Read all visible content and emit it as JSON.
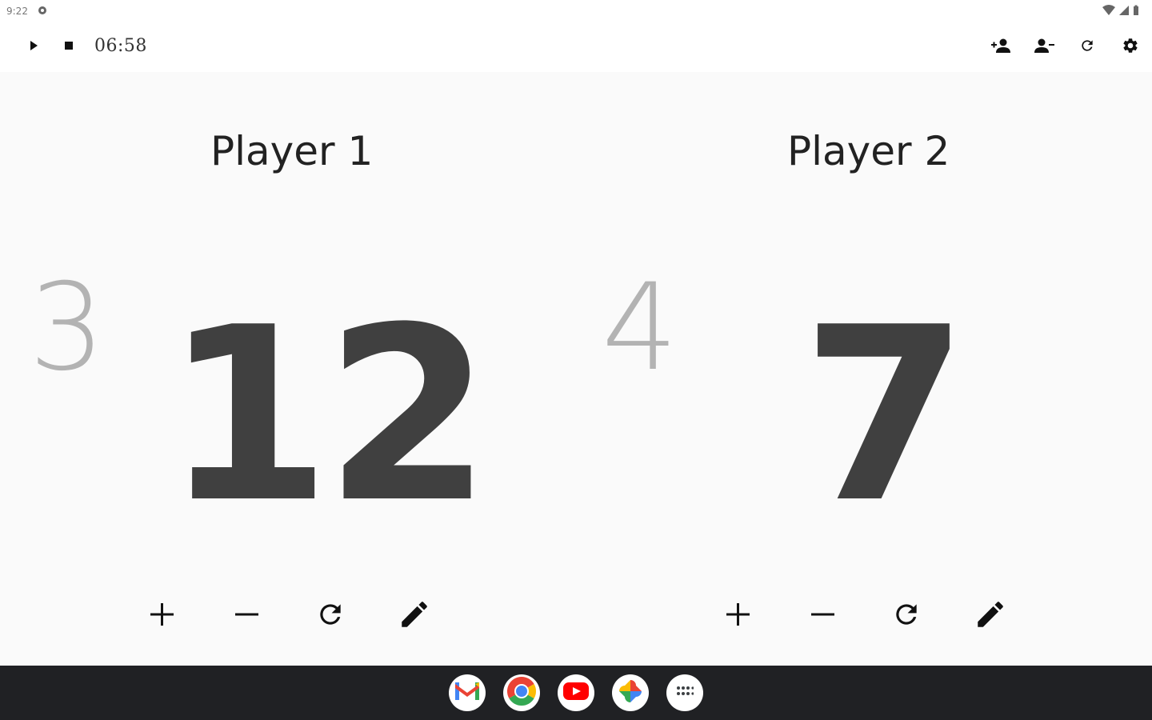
{
  "status": {
    "time": "9:22"
  },
  "toolbar": {
    "timer": "06:58",
    "icons": [
      "play-icon",
      "stop-icon",
      "add-player-icon",
      "remove-player-icon",
      "reset-all-icon",
      "settings-icon"
    ]
  },
  "players": [
    {
      "name": "Player 1",
      "small_count": "3",
      "score": "12"
    },
    {
      "name": "Player 2",
      "small_count": "4",
      "score": "7"
    }
  ],
  "controls": [
    "plus-icon",
    "minus-icon",
    "reset-icon",
    "edit-icon"
  ],
  "dock": {
    "apps": [
      "gmail-icon",
      "chrome-icon",
      "youtube-icon",
      "photos-icon",
      "app-launcher-icon"
    ]
  },
  "colors": {
    "score": "#404040",
    "small_count": "#b3b3b3",
    "taskbar": "#202124",
    "background": "#fafafa"
  }
}
